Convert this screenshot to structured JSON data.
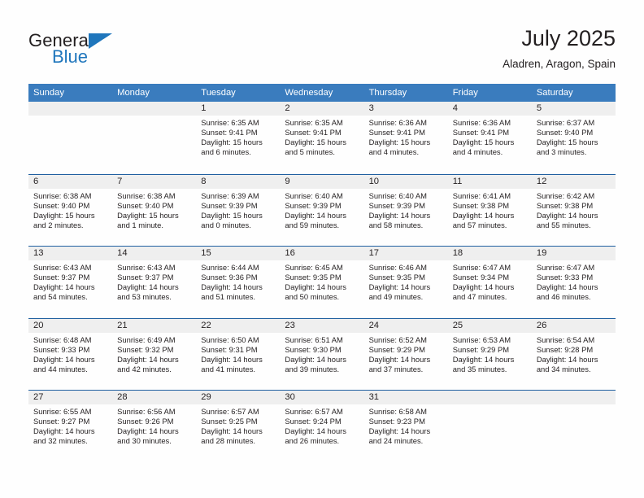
{
  "brand": {
    "word_general": "General",
    "word_blue": "Blue",
    "accent_color": "#1f76bc"
  },
  "header": {
    "title": "July 2025",
    "location": "Aladren, Aragon, Spain",
    "header_bar_color": "#3a7cbe",
    "week_divider_color": "#1f5fa0",
    "date_band_color": "#efefef"
  },
  "weekdays": [
    "Sunday",
    "Monday",
    "Tuesday",
    "Wednesday",
    "Thursday",
    "Friday",
    "Saturday"
  ],
  "labels": {
    "sunrise_prefix": "Sunrise:",
    "sunset_prefix": "Sunset:",
    "daylight_prefix": "Daylight:"
  },
  "weeks": [
    [
      {
        "empty": true
      },
      {
        "empty": true
      },
      {
        "day": "1",
        "sunrise": "Sunrise: 6:35 AM",
        "sunset": "Sunset: 9:41 PM",
        "daylight_1": "Daylight: 15 hours",
        "daylight_2": "and 6 minutes."
      },
      {
        "day": "2",
        "sunrise": "Sunrise: 6:35 AM",
        "sunset": "Sunset: 9:41 PM",
        "daylight_1": "Daylight: 15 hours",
        "daylight_2": "and 5 minutes."
      },
      {
        "day": "3",
        "sunrise": "Sunrise: 6:36 AM",
        "sunset": "Sunset: 9:41 PM",
        "daylight_1": "Daylight: 15 hours",
        "daylight_2": "and 4 minutes."
      },
      {
        "day": "4",
        "sunrise": "Sunrise: 6:36 AM",
        "sunset": "Sunset: 9:41 PM",
        "daylight_1": "Daylight: 15 hours",
        "daylight_2": "and 4 minutes."
      },
      {
        "day": "5",
        "sunrise": "Sunrise: 6:37 AM",
        "sunset": "Sunset: 9:40 PM",
        "daylight_1": "Daylight: 15 hours",
        "daylight_2": "and 3 minutes."
      }
    ],
    [
      {
        "day": "6",
        "sunrise": "Sunrise: 6:38 AM",
        "sunset": "Sunset: 9:40 PM",
        "daylight_1": "Daylight: 15 hours",
        "daylight_2": "and 2 minutes."
      },
      {
        "day": "7",
        "sunrise": "Sunrise: 6:38 AM",
        "sunset": "Sunset: 9:40 PM",
        "daylight_1": "Daylight: 15 hours",
        "daylight_2": "and 1 minute."
      },
      {
        "day": "8",
        "sunrise": "Sunrise: 6:39 AM",
        "sunset": "Sunset: 9:39 PM",
        "daylight_1": "Daylight: 15 hours",
        "daylight_2": "and 0 minutes."
      },
      {
        "day": "9",
        "sunrise": "Sunrise: 6:40 AM",
        "sunset": "Sunset: 9:39 PM",
        "daylight_1": "Daylight: 14 hours",
        "daylight_2": "and 59 minutes."
      },
      {
        "day": "10",
        "sunrise": "Sunrise: 6:40 AM",
        "sunset": "Sunset: 9:39 PM",
        "daylight_1": "Daylight: 14 hours",
        "daylight_2": "and 58 minutes."
      },
      {
        "day": "11",
        "sunrise": "Sunrise: 6:41 AM",
        "sunset": "Sunset: 9:38 PM",
        "daylight_1": "Daylight: 14 hours",
        "daylight_2": "and 57 minutes."
      },
      {
        "day": "12",
        "sunrise": "Sunrise: 6:42 AM",
        "sunset": "Sunset: 9:38 PM",
        "daylight_1": "Daylight: 14 hours",
        "daylight_2": "and 55 minutes."
      }
    ],
    [
      {
        "day": "13",
        "sunrise": "Sunrise: 6:43 AM",
        "sunset": "Sunset: 9:37 PM",
        "daylight_1": "Daylight: 14 hours",
        "daylight_2": "and 54 minutes."
      },
      {
        "day": "14",
        "sunrise": "Sunrise: 6:43 AM",
        "sunset": "Sunset: 9:37 PM",
        "daylight_1": "Daylight: 14 hours",
        "daylight_2": "and 53 minutes."
      },
      {
        "day": "15",
        "sunrise": "Sunrise: 6:44 AM",
        "sunset": "Sunset: 9:36 PM",
        "daylight_1": "Daylight: 14 hours",
        "daylight_2": "and 51 minutes."
      },
      {
        "day": "16",
        "sunrise": "Sunrise: 6:45 AM",
        "sunset": "Sunset: 9:35 PM",
        "daylight_1": "Daylight: 14 hours",
        "daylight_2": "and 50 minutes."
      },
      {
        "day": "17",
        "sunrise": "Sunrise: 6:46 AM",
        "sunset": "Sunset: 9:35 PM",
        "daylight_1": "Daylight: 14 hours",
        "daylight_2": "and 49 minutes."
      },
      {
        "day": "18",
        "sunrise": "Sunrise: 6:47 AM",
        "sunset": "Sunset: 9:34 PM",
        "daylight_1": "Daylight: 14 hours",
        "daylight_2": "and 47 minutes."
      },
      {
        "day": "19",
        "sunrise": "Sunrise: 6:47 AM",
        "sunset": "Sunset: 9:33 PM",
        "daylight_1": "Daylight: 14 hours",
        "daylight_2": "and 46 minutes."
      }
    ],
    [
      {
        "day": "20",
        "sunrise": "Sunrise: 6:48 AM",
        "sunset": "Sunset: 9:33 PM",
        "daylight_1": "Daylight: 14 hours",
        "daylight_2": "and 44 minutes."
      },
      {
        "day": "21",
        "sunrise": "Sunrise: 6:49 AM",
        "sunset": "Sunset: 9:32 PM",
        "daylight_1": "Daylight: 14 hours",
        "daylight_2": "and 42 minutes."
      },
      {
        "day": "22",
        "sunrise": "Sunrise: 6:50 AM",
        "sunset": "Sunset: 9:31 PM",
        "daylight_1": "Daylight: 14 hours",
        "daylight_2": "and 41 minutes."
      },
      {
        "day": "23",
        "sunrise": "Sunrise: 6:51 AM",
        "sunset": "Sunset: 9:30 PM",
        "daylight_1": "Daylight: 14 hours",
        "daylight_2": "and 39 minutes."
      },
      {
        "day": "24",
        "sunrise": "Sunrise: 6:52 AM",
        "sunset": "Sunset: 9:29 PM",
        "daylight_1": "Daylight: 14 hours",
        "daylight_2": "and 37 minutes."
      },
      {
        "day": "25",
        "sunrise": "Sunrise: 6:53 AM",
        "sunset": "Sunset: 9:29 PM",
        "daylight_1": "Daylight: 14 hours",
        "daylight_2": "and 35 minutes."
      },
      {
        "day": "26",
        "sunrise": "Sunrise: 6:54 AM",
        "sunset": "Sunset: 9:28 PM",
        "daylight_1": "Daylight: 14 hours",
        "daylight_2": "and 34 minutes."
      }
    ],
    [
      {
        "day": "27",
        "sunrise": "Sunrise: 6:55 AM",
        "sunset": "Sunset: 9:27 PM",
        "daylight_1": "Daylight: 14 hours",
        "daylight_2": "and 32 minutes."
      },
      {
        "day": "28",
        "sunrise": "Sunrise: 6:56 AM",
        "sunset": "Sunset: 9:26 PM",
        "daylight_1": "Daylight: 14 hours",
        "daylight_2": "and 30 minutes."
      },
      {
        "day": "29",
        "sunrise": "Sunrise: 6:57 AM",
        "sunset": "Sunset: 9:25 PM",
        "daylight_1": "Daylight: 14 hours",
        "daylight_2": "and 28 minutes."
      },
      {
        "day": "30",
        "sunrise": "Sunrise: 6:57 AM",
        "sunset": "Sunset: 9:24 PM",
        "daylight_1": "Daylight: 14 hours",
        "daylight_2": "and 26 minutes."
      },
      {
        "day": "31",
        "sunrise": "Sunrise: 6:58 AM",
        "sunset": "Sunset: 9:23 PM",
        "daylight_1": "Daylight: 14 hours",
        "daylight_2": "and 24 minutes."
      },
      {
        "empty": true
      },
      {
        "empty": true
      }
    ]
  ]
}
